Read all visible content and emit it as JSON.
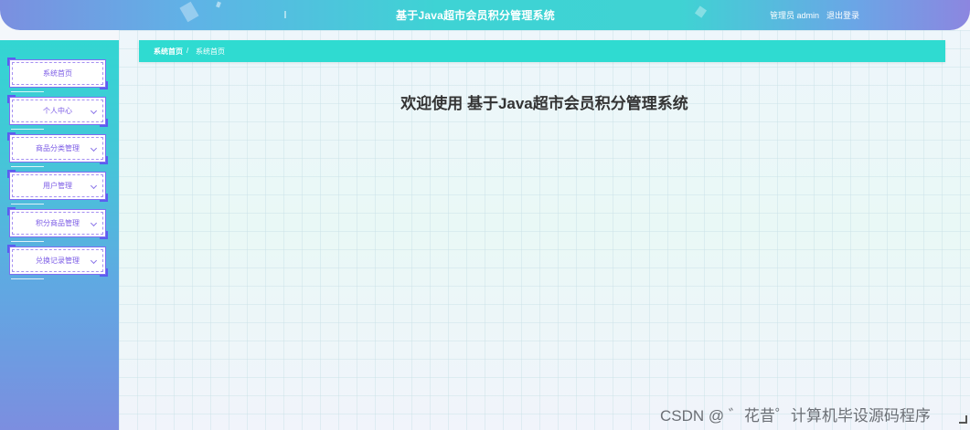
{
  "header": {
    "title": "基于Java超市会员积分管理系统",
    "user": "管理员 admin",
    "logout": "退出登录"
  },
  "sidebar": {
    "items": [
      {
        "label": "系统首页",
        "has_chevron": false
      },
      {
        "label": "个人中心",
        "has_chevron": true
      },
      {
        "label": "商品分类管理",
        "has_chevron": true
      },
      {
        "label": "用户管理",
        "has_chevron": true
      },
      {
        "label": "积分商品管理",
        "has_chevron": true
      },
      {
        "label": "兑换记录管理",
        "has_chevron": true
      }
    ]
  },
  "breadcrumb": {
    "home": "系统首页",
    "separator": "/",
    "current": "系统首页"
  },
  "main": {
    "welcome": "欢迎使用 基于Java超市会员积分管理系统"
  },
  "watermark": "CSDN @ ゛花昔゜计算机毕设源码程序",
  "colors": {
    "accent": "#2fdbd1",
    "menu_text": "#7c5ce6",
    "menu_corner": "#5a5ef0"
  }
}
